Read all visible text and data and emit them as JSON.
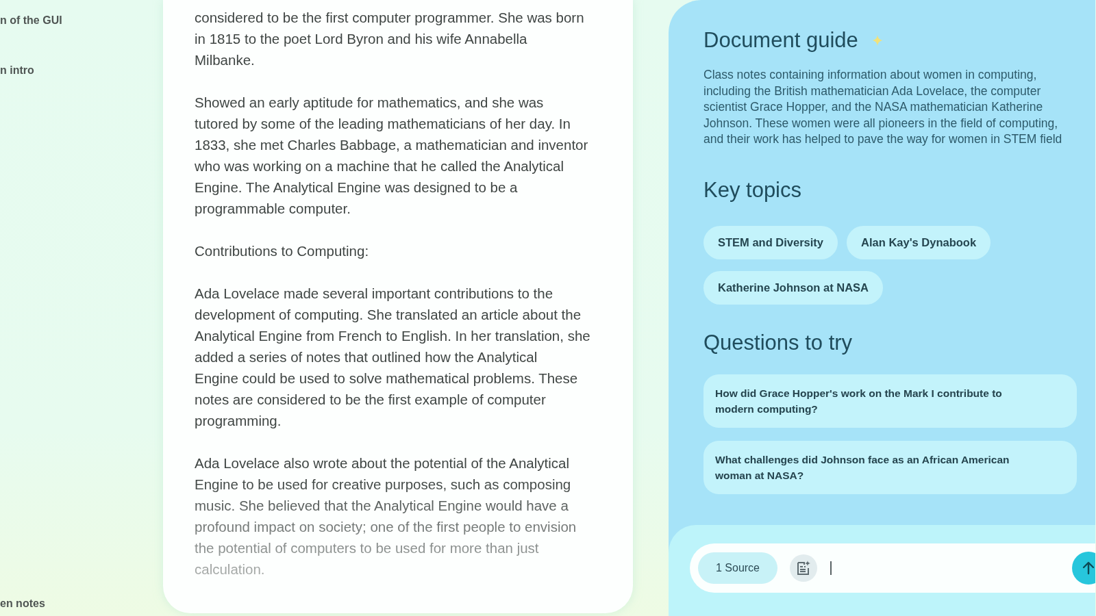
{
  "sidebar": {
    "items": [
      {
        "label": "n of the GUI"
      },
      {
        "label": "n intro"
      }
    ],
    "bottom_items": [
      {
        "label": "en notes"
      }
    ]
  },
  "document": {
    "paragraphs": [
      {
        "lines": [
          "considered to be the first computer programmer. She was born",
          "in 1815 to the poet Lord Byron and his wife Annabella",
          "Milbanke."
        ]
      },
      {
        "lines": [
          "Showed an early aptitude for mathematics, and she was",
          "tutored by some of the leading mathematicians of her day. In",
          "1833, she met Charles Babbage, a mathematician and inventor",
          "who was working on a machine that he called the Analytical",
          "Engine. The Analytical Engine was designed to be a",
          "programmable computer."
        ]
      },
      {
        "lines": [
          "Contributions to Computing:"
        ]
      },
      {
        "lines": [
          "Ada Lovelace made several important contributions to the",
          "development of computing. She translated an article about the",
          "Analytical Engine from French to English. In her translation, she",
          "added a series of notes that outlined how the Analytical",
          "Engine could be used to solve mathematical problems. These",
          "notes are considered to be the first example of computer",
          "programming."
        ]
      },
      {
        "lines": [
          "Ada Lovelace also wrote about the potential of the Analytical",
          "Engine to be used for creative purposes, such as composing",
          "music. She believed that the Analytical Engine would have a",
          "profound impact on society; one of the first people to envision",
          "the potential of computers to be used for more than just",
          "calculation."
        ]
      }
    ]
  },
  "guide": {
    "title": "Document guide",
    "summary": {
      "lines": [
        "Class notes containing information about women in computing,",
        "including the British mathematician Ada Lovelace, the computer",
        "scientist Grace Hopper, and the NASA mathematician Katherine",
        "Johnson. These women were all pioneers in the field of computing,",
        "and their work has helped to pave the way for women in STEM field"
      ]
    },
    "key_topics": {
      "title": "Key topics",
      "chips": [
        "STEM and Diversity",
        "Alan Kay's Dynabook",
        "Katherine Johnson at NASA"
      ]
    },
    "questions": {
      "title": "Questions to try",
      "items": [
        "How did Grace Hopper's work on the Mark I contribute to modern computing?",
        "What challenges did Johnson face as an African American woman at NASA?"
      ]
    }
  },
  "composer": {
    "source_button": "1 Source"
  }
}
